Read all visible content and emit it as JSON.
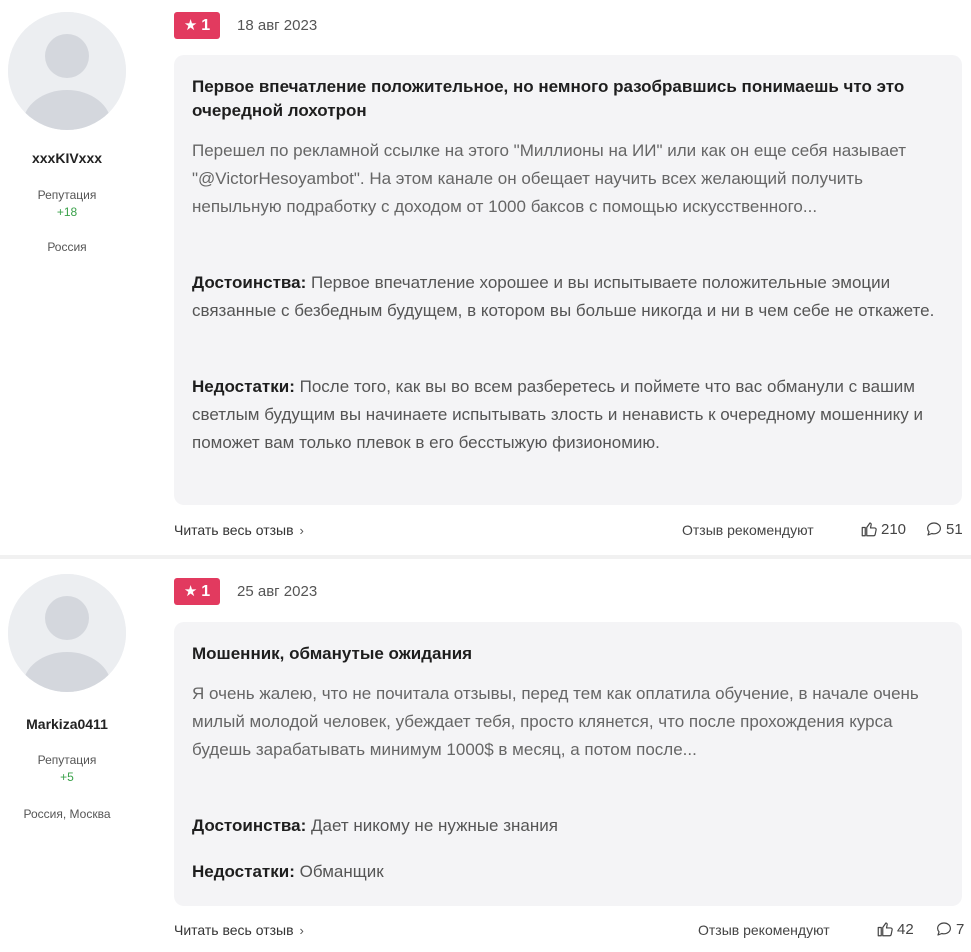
{
  "reviews": [
    {
      "author": {
        "name": "xxxKIVxxx",
        "reputation_label": "Репутация",
        "reputation_value": "+18",
        "location": "Россия"
      },
      "rating": "1",
      "date": "18 авг 2023",
      "title": "Первое впечатление положительное, но немного разобравшись понимаешь что это очередной лохотрон",
      "text": "Перешел по рекламной ссылке на этого \"Миллионы на ИИ\" или как он еще себя называет \"@VictorHesoyambot\". На этом канале он обещает научить всех желающий получить непыльную подработку с доходом от 1000 баксов с помощью искусственного...",
      "pros_label": "Достоинства:",
      "pros": "Первое впечатление хорошее и вы испытываете положительные эмоции связанные с безбедным будущем, в котором вы больше никогда и ни в чем себе не откажете.",
      "cons_label": "Недостатки:",
      "cons": "После того, как вы во всем разберетесь и поймете что вас обманули с вашим светлым будущим вы начинаете испытывать злость и ненависть к очередному мошеннику и поможет вам только плевок в его бесстыжую физиономию.",
      "read_more": "Читать весь отзыв",
      "recommend_label": "Отзыв рекомендуют",
      "likes": "210",
      "comments": "51"
    },
    {
      "author": {
        "name": "Markiza0411",
        "reputation_label": "Репутация",
        "reputation_value": "+5",
        "location": "Россия, Москва"
      },
      "rating": "1",
      "date": "25 авг 2023",
      "title": "Мошенник, обманутые ожидания",
      "text": "Я очень жалею, что не почитала отзывы, перед тем как оплатила обучение, в начале очень милый молодой человек, убеждает тебя, просто клянется, что после прохождения курса будешь зарабатывать минимум 1000$ в месяц, а потом после...",
      "pros_label": "Достоинства:",
      "pros": "Дает никому не нужные знания",
      "cons_label": "Недостатки:",
      "cons": "Обманщик",
      "read_more": "Читать весь отзыв",
      "recommend_label": "Отзыв рекомендуют",
      "likes": "42",
      "comments": "7"
    }
  ],
  "colors": {
    "rating_badge": "#e23a5f",
    "reputation": "#3aa14a",
    "card_background": "#f4f4f6"
  },
  "icons": {
    "rating": "star-icon",
    "read_more": "chevron-right-icon",
    "likes": "thumbs-up-icon",
    "comments": "comment-bubble-icon",
    "avatar": "default-user-avatar"
  }
}
